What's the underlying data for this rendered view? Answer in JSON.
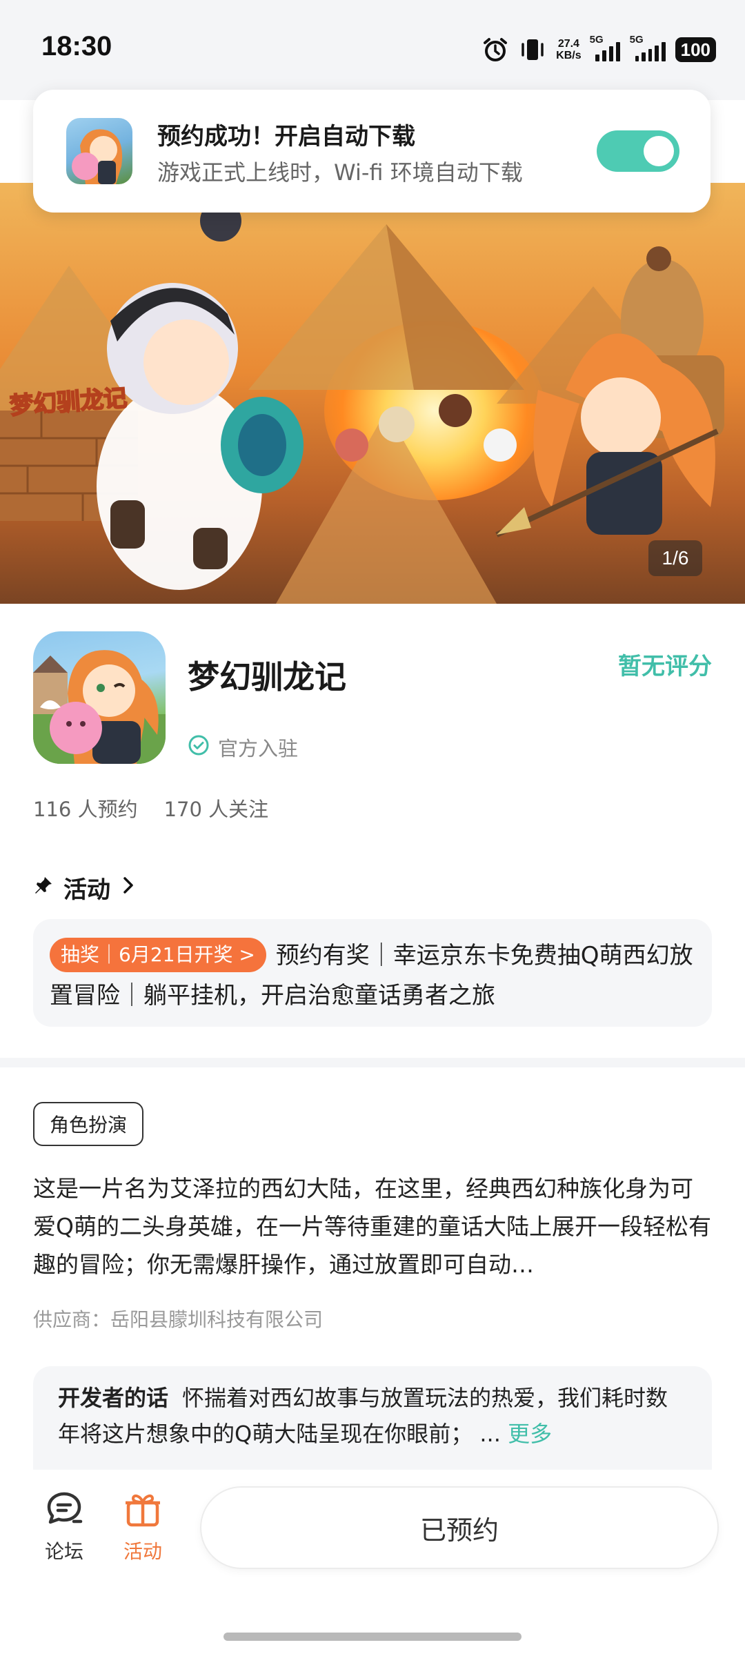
{
  "status_bar": {
    "time": "18:30",
    "net_speed_value": "27.4",
    "net_speed_unit": "KB/s",
    "signal_1": "5G",
    "signal_2": "5G",
    "battery": "100"
  },
  "toast": {
    "title": "预约成功！开启自动下载",
    "subtitle": "游戏正式上线时，Wi-fi 环境自动下载",
    "toggle_on": true
  },
  "hero": {
    "page_counter": "1/6",
    "logo_text": "梦幻驯龙记"
  },
  "app": {
    "name": "梦幻驯龙记",
    "rating": "暂无评分",
    "official": "官方入驻",
    "reservations": "116 人预约",
    "followers": "170 人关注"
  },
  "activity": {
    "heading": "活动",
    "tag": "抽奖｜6月21日开奖 >",
    "text": "预约有奖｜幸运京东卡免费抽Q萌西幻放置冒险｜躺平挂机，开启治愈童话勇者之旅"
  },
  "description": {
    "genre": "角色扮演",
    "text": "这是一片名为艾泽拉的西幻大陆，在这里，经典西幻种族化身为可爱Q萌的二头身英雄，在一片等待重建的童话大陆上展开一段轻松有趣的冒险；你无需爆肝操作，通过放置即可自动…",
    "supplier": "供应商：岳阳县朦圳科技有限公司"
  },
  "developer": {
    "label": "开发者的话",
    "text": "怀揣着对西幻故事与放置玩法的热爱，我们耗时数年将这片想象中的Q萌大陆呈现在你眼前；",
    "ellipsis": "...",
    "more": "更多"
  },
  "bottom_bar": {
    "forum_label": "论坛",
    "activity_label": "活动",
    "reserved_label": "已预约"
  },
  "colors": {
    "accent": "#41bea9",
    "toggle": "#4ecbb3",
    "lottery": "#f5733c",
    "activity_tab": "#f0783c"
  }
}
